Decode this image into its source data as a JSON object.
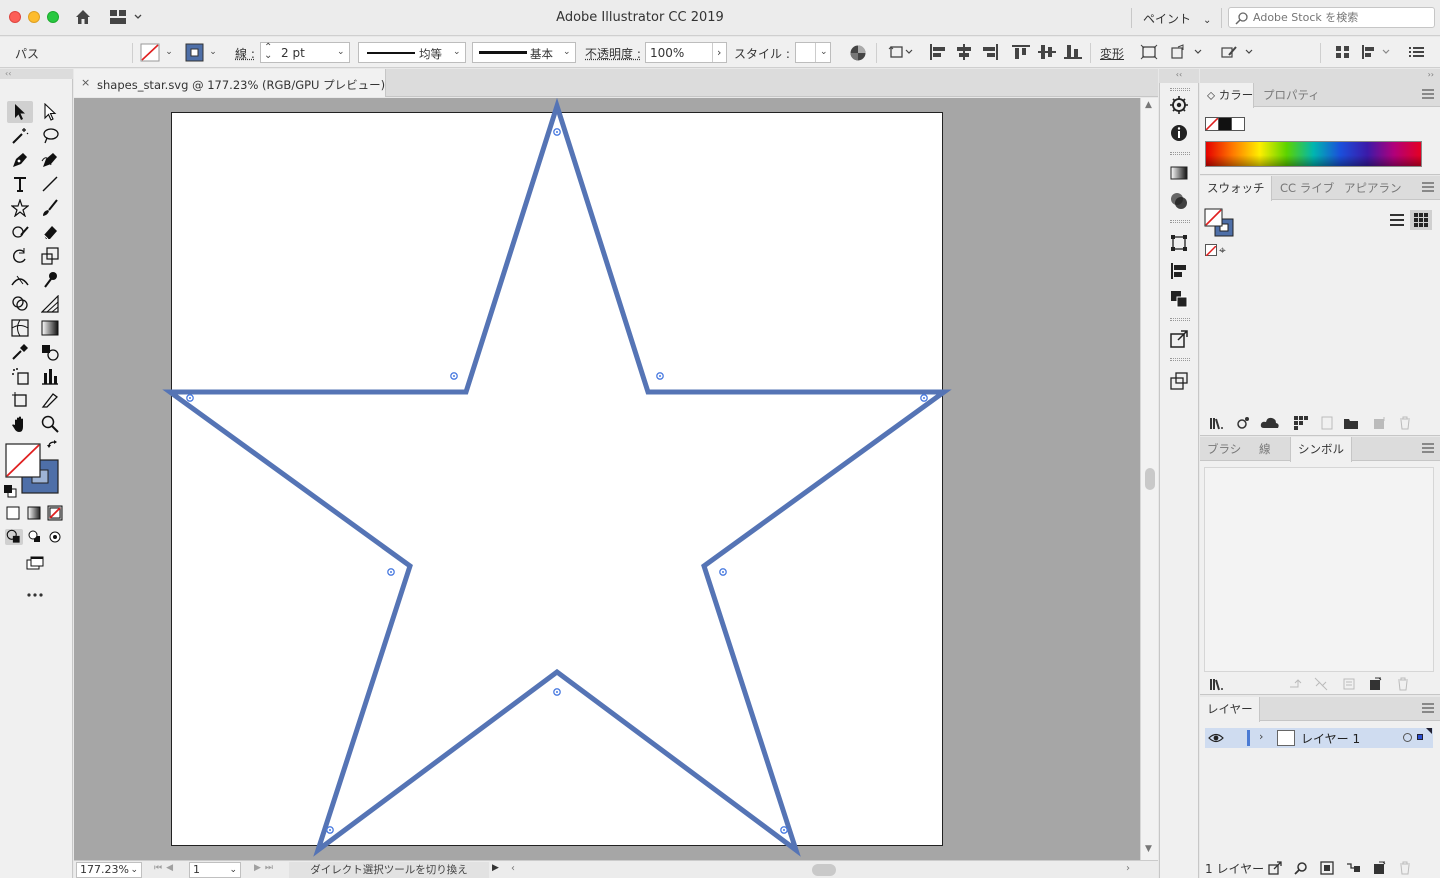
{
  "window": {
    "title": "Adobe Illustrator CC 2019",
    "workspace_menu": "ペイント",
    "stock_search_placeholder": "Adobe Stock を検索"
  },
  "control_bar": {
    "selection_type": "パス",
    "stroke_label": "線 :",
    "stroke_weight": "2 pt",
    "profile_label": "均等",
    "brush_label": "基本",
    "opacity_label": "不透明度 :",
    "opacity_value": "100%",
    "style_label": "スタイル :",
    "transform_label": "変形"
  },
  "document": {
    "tab_title": "shapes_star.svg @ 177.23% (RGB/GPU プレビュー)",
    "close_glyph": "×",
    "stroke_color": "#5574b5"
  },
  "status_bar": {
    "zoom": "177.23%",
    "artboard_number": "1",
    "status_text": "ダイレクト選択ツールを切り換え"
  },
  "color_panel": {
    "tabs": [
      "カラー",
      "プロパティ"
    ]
  },
  "swatches_panel": {
    "tabs": [
      "スウォッチ",
      "CC ライブ",
      "アピアラン"
    ]
  },
  "symbols_panel": {
    "tabs": [
      "ブラシ",
      "線",
      "シンボル"
    ]
  },
  "layers_panel": {
    "tabs": [
      "レイヤー"
    ],
    "layers": [
      {
        "name": "レイヤー 1",
        "expand_glyph": "›"
      }
    ],
    "footer_count": "1 レイヤー"
  },
  "collapse_glyphs": {
    "left": "‹‹",
    "right": "››"
  }
}
